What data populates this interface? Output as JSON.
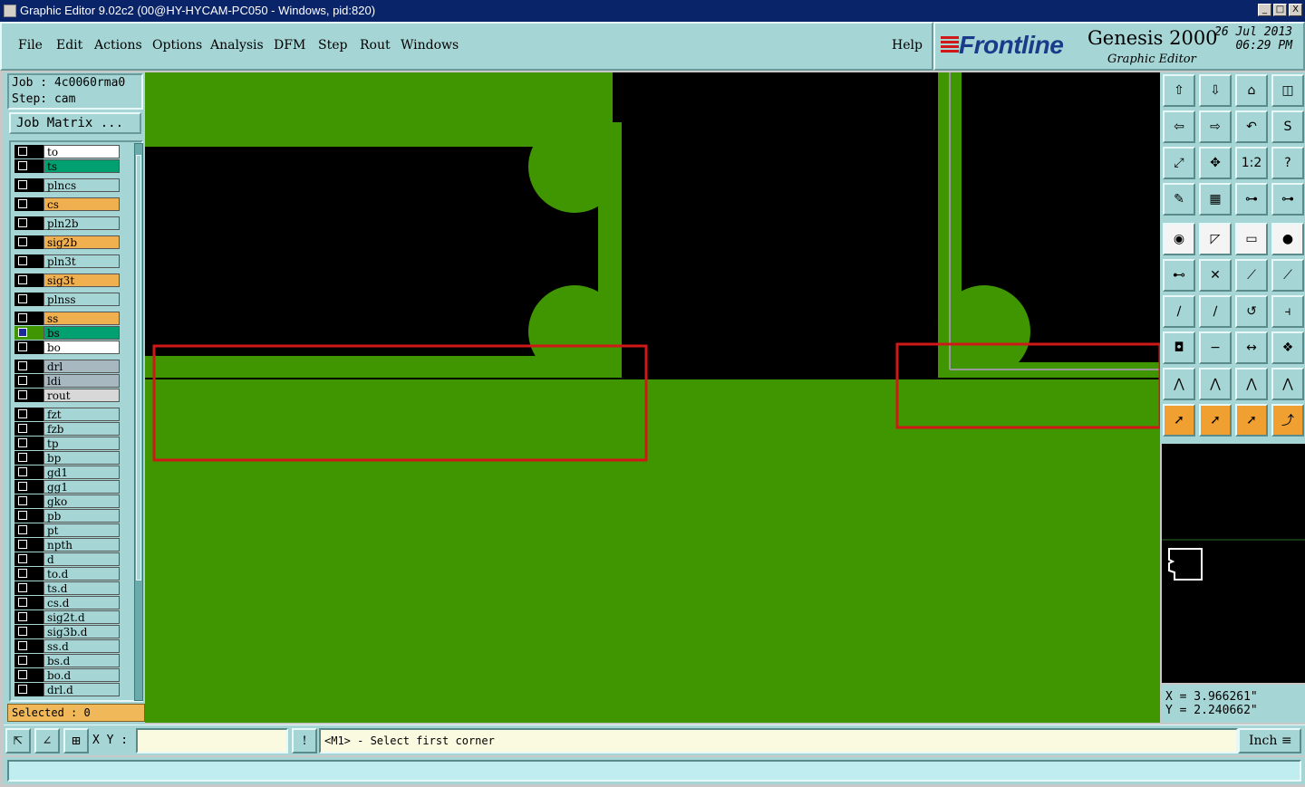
{
  "window": {
    "title": "Graphic Editor 9.02c2 (00@HY-HYCAM-PC050 - Windows, pid:820)",
    "controls": [
      "_",
      "□",
      "X"
    ]
  },
  "menu": {
    "items": [
      {
        "label": "File",
        "underline": true
      },
      {
        "label": "Edit",
        "underline": true
      },
      {
        "label": "Actions",
        "underline": true
      },
      {
        "label": "Options",
        "underline": true
      },
      {
        "label": "Analysis",
        "underline": true
      },
      {
        "label": "DFM",
        "underline": true
      },
      {
        "label": "Step",
        "underline": true
      },
      {
        "label": "Rout",
        "underline": true
      },
      {
        "label": "Windows",
        "underline": true
      }
    ],
    "help": "Help"
  },
  "brand": {
    "logo": "Frontline",
    "product": "Genesis 2000",
    "subtitle": "Graphic Editor",
    "date": "26 Jul 2013",
    "time": "06:29 PM"
  },
  "job": {
    "job_line": "Job : 4c0060rma0",
    "step_line": "Step: cam",
    "matrix_button": "Job Matrix ..."
  },
  "layers": [
    {
      "name": "to",
      "color": "#ffffff",
      "group": 0
    },
    {
      "name": "ts",
      "color": "#00a070",
      "group": 0
    },
    {
      "name": "plncs",
      "color": "#a5d5d5",
      "group": 1
    },
    {
      "name": "cs",
      "color": "#f0b050",
      "group": 2
    },
    {
      "name": "pln2b",
      "color": "#a5d5d5",
      "group": 3
    },
    {
      "name": "sig2b",
      "color": "#f0b050",
      "group": 4
    },
    {
      "name": "pln3t",
      "color": "#a5d5d5",
      "group": 5
    },
    {
      "name": "sig3t",
      "color": "#f0b050",
      "group": 6
    },
    {
      "name": "plnss",
      "color": "#a5d5d5",
      "group": 7
    },
    {
      "name": "ss",
      "color": "#f0b050",
      "group": 8
    },
    {
      "name": "bs",
      "color": "#00a070",
      "group": 8,
      "active": true
    },
    {
      "name": "bo",
      "color": "#ffffff",
      "group": 8
    },
    {
      "name": "drl",
      "color": "#a8b8c0",
      "group": 9
    },
    {
      "name": "ldi",
      "color": "#a8b8c0",
      "group": 9
    },
    {
      "name": "rout",
      "color": "#d8d8d8",
      "group": 9
    },
    {
      "name": "fzt",
      "color": "#a5d5d5",
      "group": 10
    },
    {
      "name": "fzb",
      "color": "#a5d5d5",
      "group": 10
    },
    {
      "name": "tp",
      "color": "#a5d5d5",
      "group": 10
    },
    {
      "name": "bp",
      "color": "#a5d5d5",
      "group": 10
    },
    {
      "name": "gd1",
      "color": "#a5d5d5",
      "group": 10
    },
    {
      "name": "gg1",
      "color": "#a5d5d5",
      "group": 10
    },
    {
      "name": "gko",
      "color": "#a5d5d5",
      "group": 10
    },
    {
      "name": "pb",
      "color": "#a5d5d5",
      "group": 10
    },
    {
      "name": "pt",
      "color": "#a5d5d5",
      "group": 10
    },
    {
      "name": "npth",
      "color": "#a5d5d5",
      "group": 10
    },
    {
      "name": "d",
      "color": "#a5d5d5",
      "group": 10
    },
    {
      "name": "to.d",
      "color": "#a5d5d5",
      "group": 10
    },
    {
      "name": "ts.d",
      "color": "#a5d5d5",
      "group": 10
    },
    {
      "name": "cs.d",
      "color": "#a5d5d5",
      "group": 10
    },
    {
      "name": "sig2t.d",
      "color": "#a5d5d5",
      "group": 10
    },
    {
      "name": "sig3b.d",
      "color": "#a5d5d5",
      "group": 10
    },
    {
      "name": "ss.d",
      "color": "#a5d5d5",
      "group": 10
    },
    {
      "name": "bs.d",
      "color": "#a5d5d5",
      "group": 10
    },
    {
      "name": "bo.d",
      "color": "#a5d5d5",
      "group": 10
    },
    {
      "name": "drl.d",
      "color": "#a5d5d5",
      "group": 10
    }
  ],
  "selected": "Selected : 0",
  "tools": {
    "rows": [
      [
        "home-icon",
        "down-icon",
        "house-icon",
        "split-icon"
      ],
      [
        "left-icon",
        "right-icon",
        "undo-icon",
        "s-icon"
      ],
      [
        "fit-icon",
        "zoom-icon",
        "1:2",
        "?"
      ],
      [
        "pen-icon",
        "grid-icon",
        "net-icon",
        "net-icon"
      ],
      [
        "circle-icon",
        "diag-icon",
        "ruler-icon",
        "dot-icon"
      ],
      [
        "connect-icon",
        "cross-icon",
        "link-icon",
        "link-icon"
      ],
      [
        "line-icon",
        "line-icon",
        "arc-icon",
        "fx-icon"
      ],
      [
        "pad-icon",
        "minus-icon",
        "measure-icon",
        "pads-icon"
      ],
      [
        "angle-icon",
        "angle-icon",
        "angle-icon",
        "angle-icon"
      ],
      [
        "pointer-icon",
        "pointer-icon",
        "pointer-icon",
        "route-icon"
      ]
    ]
  },
  "coords": {
    "x": "X = 3.966261\"",
    "y": "Y = 2.240662\""
  },
  "status": {
    "xy_label": "X Y :",
    "xy_value": "",
    "prompt": "<M1> - Select first corner",
    "units": "Inch",
    "message": ""
  },
  "colors": {
    "copper": "#3f9600",
    "highlight": "#d01818",
    "panel": "#a5d5d5"
  }
}
